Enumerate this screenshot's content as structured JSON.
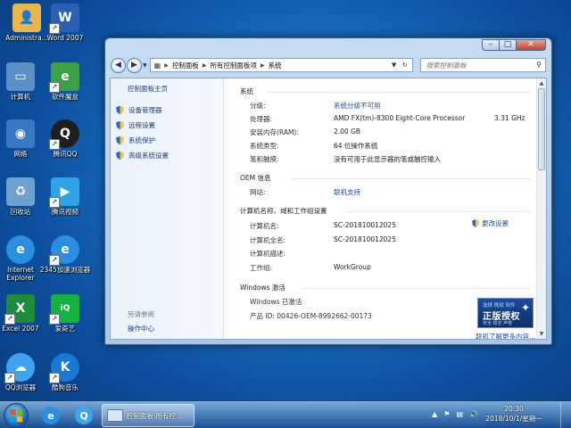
{
  "desktop": {
    "icons": [
      {
        "label": "Administra...",
        "icon": "user-folder-icon",
        "color": "#e8b64a"
      },
      {
        "label": "Word 2007",
        "icon": "word-icon",
        "color": "#2b5fb5"
      },
      {
        "label": "计算机",
        "icon": "computer-icon",
        "color": "#5b8fc8"
      },
      {
        "label": "软件魔盒",
        "icon": "software-box-icon",
        "color": "#3ca046"
      },
      {
        "label": "网络",
        "icon": "network-icon",
        "color": "#3a78c2"
      },
      {
        "label": "腾讯QQ",
        "icon": "qq-icon",
        "color": "#1e1e1e"
      },
      {
        "label": "回收站",
        "icon": "recycle-bin-icon",
        "color": "#6ea0d0"
      },
      {
        "label": "腾讯视频",
        "icon": "tencent-video-icon",
        "color": "#2fa3e6"
      },
      {
        "label": "Internet Explorer",
        "icon": "ie-icon",
        "color": "#2a8fe0"
      },
      {
        "label": "2345加速浏览器",
        "icon": "browser-2345-icon",
        "color": "#2a8fe0"
      },
      {
        "label": "Excel 2007",
        "icon": "excel-icon",
        "color": "#1e8a3c"
      },
      {
        "label": "爱奇艺",
        "icon": "iqiyi-icon",
        "color": "#16b23e"
      },
      {
        "label": "QQ浏览器",
        "icon": "qq-browser-icon",
        "color": "#3ea4f0"
      },
      {
        "label": "酷狗音乐",
        "icon": "kugou-icon",
        "color": "#1978d6"
      }
    ]
  },
  "window": {
    "controls": {
      "minimize": "–",
      "maximize": "□",
      "close": "✕"
    },
    "breadcrumb": [
      "控制面板",
      "所有控制面板项",
      "系统"
    ],
    "search_placeholder": "搜索控制面板",
    "left_pane": {
      "home": "控制面板主页",
      "items": [
        "设备管理器",
        "远程设置",
        "系统保护",
        "高级系统设置"
      ],
      "see_also": "另请参阅",
      "action_center": "操作中心"
    },
    "system": {
      "title": "系统",
      "rows": [
        {
          "label": "分级:",
          "value": "系统分级不可用",
          "link": true
        },
        {
          "label": "处理器:",
          "value": "AMD FX(tm)-8300 Eight-Core Processor",
          "link": false
        },
        {
          "label": "安装内存(RAM):",
          "value": "2.00 GB",
          "link": false
        },
        {
          "label": "系统类型:",
          "value": "64 位操作系统",
          "link": false
        },
        {
          "label": "笔和触摸:",
          "value": "没有可用于此显示器的笔或触控输入",
          "link": false
        }
      ],
      "cpu_speed": "3.31 GHz"
    },
    "oem": {
      "title": "OEM 信息",
      "website_label": "网站:",
      "website_value": "联机支持"
    },
    "computer_name": {
      "title": "计算机名称、域和工作组设置",
      "rows": [
        {
          "label": "计算机名:",
          "value": "SC-201810012025"
        },
        {
          "label": "计算机全名:",
          "value": "SC-201810012025"
        },
        {
          "label": "计算机描述:",
          "value": ""
        },
        {
          "label": "工作组:",
          "value": "WorkGroup"
        }
      ],
      "change_settings": "更改设置"
    },
    "activation": {
      "title": "Windows 激活",
      "status": "Windows 已激活",
      "product_id": "产品 ID: 00426-OEM-8992662-00173",
      "badge_top": "选择 微软 软件",
      "badge_main": "正版授权",
      "badge_bottom": "安全 稳定 声誉",
      "more_link": "联机了解更多内容..."
    }
  },
  "taskbar": {
    "start_icon": "windows-start-icon",
    "pinned": [
      {
        "icon": "ie-taskbar-icon",
        "color": "#2a8fe0",
        "glyph": "e"
      },
      {
        "icon": "qq-browser-taskbar-icon",
        "color": "#3ea4f0",
        "glyph": "Q"
      }
    ],
    "task_label": "控制面板\\所有控...",
    "clock_time": "20:30",
    "clock_date": "2018/10/1/星期一",
    "tray_icons": [
      "chevron-up-icon",
      "flag-icon",
      "network-tray-icon",
      "volume-icon"
    ]
  }
}
